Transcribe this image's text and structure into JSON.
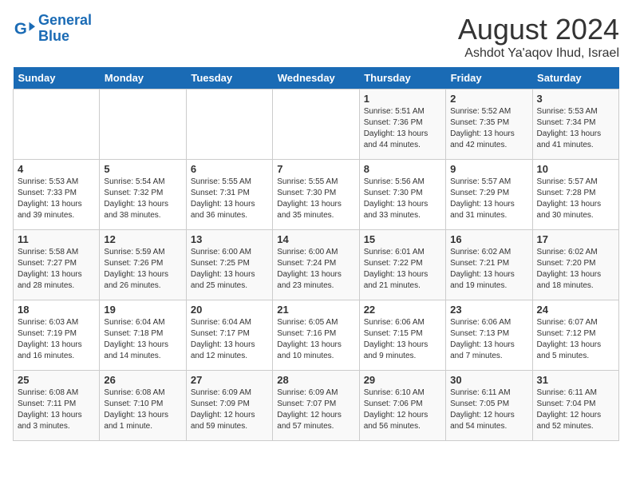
{
  "header": {
    "logo_line1": "General",
    "logo_line2": "Blue",
    "month_year": "August 2024",
    "location": "Ashdot Ya'aqov Ihud, Israel"
  },
  "weekdays": [
    "Sunday",
    "Monday",
    "Tuesday",
    "Wednesday",
    "Thursday",
    "Friday",
    "Saturday"
  ],
  "weeks": [
    [
      {
        "day": "",
        "info": ""
      },
      {
        "day": "",
        "info": ""
      },
      {
        "day": "",
        "info": ""
      },
      {
        "day": "",
        "info": ""
      },
      {
        "day": "1",
        "info": "Sunrise: 5:51 AM\nSunset: 7:36 PM\nDaylight: 13 hours\nand 44 minutes."
      },
      {
        "day": "2",
        "info": "Sunrise: 5:52 AM\nSunset: 7:35 PM\nDaylight: 13 hours\nand 42 minutes."
      },
      {
        "day": "3",
        "info": "Sunrise: 5:53 AM\nSunset: 7:34 PM\nDaylight: 13 hours\nand 41 minutes."
      }
    ],
    [
      {
        "day": "4",
        "info": "Sunrise: 5:53 AM\nSunset: 7:33 PM\nDaylight: 13 hours\nand 39 minutes."
      },
      {
        "day": "5",
        "info": "Sunrise: 5:54 AM\nSunset: 7:32 PM\nDaylight: 13 hours\nand 38 minutes."
      },
      {
        "day": "6",
        "info": "Sunrise: 5:55 AM\nSunset: 7:31 PM\nDaylight: 13 hours\nand 36 minutes."
      },
      {
        "day": "7",
        "info": "Sunrise: 5:55 AM\nSunset: 7:30 PM\nDaylight: 13 hours\nand 35 minutes."
      },
      {
        "day": "8",
        "info": "Sunrise: 5:56 AM\nSunset: 7:30 PM\nDaylight: 13 hours\nand 33 minutes."
      },
      {
        "day": "9",
        "info": "Sunrise: 5:57 AM\nSunset: 7:29 PM\nDaylight: 13 hours\nand 31 minutes."
      },
      {
        "day": "10",
        "info": "Sunrise: 5:57 AM\nSunset: 7:28 PM\nDaylight: 13 hours\nand 30 minutes."
      }
    ],
    [
      {
        "day": "11",
        "info": "Sunrise: 5:58 AM\nSunset: 7:27 PM\nDaylight: 13 hours\nand 28 minutes."
      },
      {
        "day": "12",
        "info": "Sunrise: 5:59 AM\nSunset: 7:26 PM\nDaylight: 13 hours\nand 26 minutes."
      },
      {
        "day": "13",
        "info": "Sunrise: 6:00 AM\nSunset: 7:25 PM\nDaylight: 13 hours\nand 25 minutes."
      },
      {
        "day": "14",
        "info": "Sunrise: 6:00 AM\nSunset: 7:24 PM\nDaylight: 13 hours\nand 23 minutes."
      },
      {
        "day": "15",
        "info": "Sunrise: 6:01 AM\nSunset: 7:22 PM\nDaylight: 13 hours\nand 21 minutes."
      },
      {
        "day": "16",
        "info": "Sunrise: 6:02 AM\nSunset: 7:21 PM\nDaylight: 13 hours\nand 19 minutes."
      },
      {
        "day": "17",
        "info": "Sunrise: 6:02 AM\nSunset: 7:20 PM\nDaylight: 13 hours\nand 18 minutes."
      }
    ],
    [
      {
        "day": "18",
        "info": "Sunrise: 6:03 AM\nSunset: 7:19 PM\nDaylight: 13 hours\nand 16 minutes."
      },
      {
        "day": "19",
        "info": "Sunrise: 6:04 AM\nSunset: 7:18 PM\nDaylight: 13 hours\nand 14 minutes."
      },
      {
        "day": "20",
        "info": "Sunrise: 6:04 AM\nSunset: 7:17 PM\nDaylight: 13 hours\nand 12 minutes."
      },
      {
        "day": "21",
        "info": "Sunrise: 6:05 AM\nSunset: 7:16 PM\nDaylight: 13 hours\nand 10 minutes."
      },
      {
        "day": "22",
        "info": "Sunrise: 6:06 AM\nSunset: 7:15 PM\nDaylight: 13 hours\nand 9 minutes."
      },
      {
        "day": "23",
        "info": "Sunrise: 6:06 AM\nSunset: 7:13 PM\nDaylight: 13 hours\nand 7 minutes."
      },
      {
        "day": "24",
        "info": "Sunrise: 6:07 AM\nSunset: 7:12 PM\nDaylight: 13 hours\nand 5 minutes."
      }
    ],
    [
      {
        "day": "25",
        "info": "Sunrise: 6:08 AM\nSunset: 7:11 PM\nDaylight: 13 hours\nand 3 minutes."
      },
      {
        "day": "26",
        "info": "Sunrise: 6:08 AM\nSunset: 7:10 PM\nDaylight: 13 hours\nand 1 minute."
      },
      {
        "day": "27",
        "info": "Sunrise: 6:09 AM\nSunset: 7:09 PM\nDaylight: 12 hours\nand 59 minutes."
      },
      {
        "day": "28",
        "info": "Sunrise: 6:09 AM\nSunset: 7:07 PM\nDaylight: 12 hours\nand 57 minutes."
      },
      {
        "day": "29",
        "info": "Sunrise: 6:10 AM\nSunset: 7:06 PM\nDaylight: 12 hours\nand 56 minutes."
      },
      {
        "day": "30",
        "info": "Sunrise: 6:11 AM\nSunset: 7:05 PM\nDaylight: 12 hours\nand 54 minutes."
      },
      {
        "day": "31",
        "info": "Sunrise: 6:11 AM\nSunset: 7:04 PM\nDaylight: 12 hours\nand 52 minutes."
      }
    ]
  ]
}
